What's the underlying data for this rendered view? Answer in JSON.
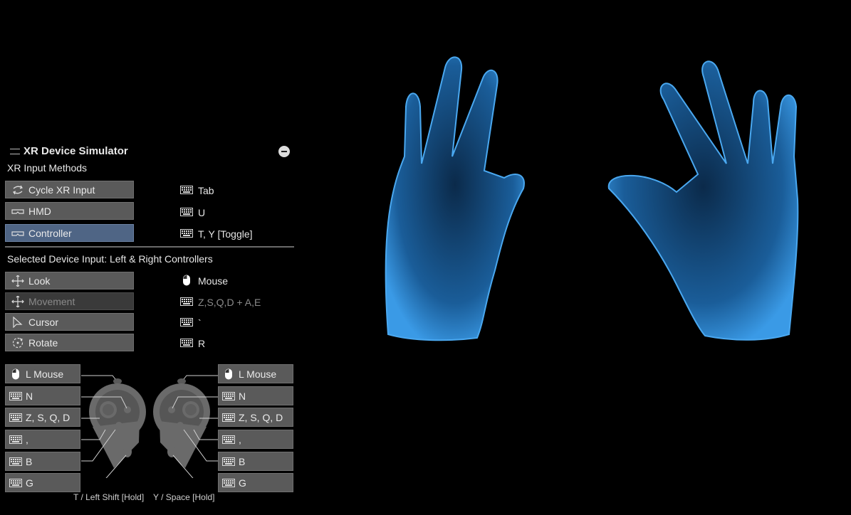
{
  "panel": {
    "title": "XR Device Simulator",
    "input_methods_label": "XR Input Methods",
    "input_methods": [
      {
        "label": "Cycle XR Input",
        "icon": "cycle-icon",
        "key": "Tab",
        "key_icon": "keyboard-icon",
        "state": "normal"
      },
      {
        "label": "HMD",
        "icon": "headset-icon",
        "key": "U",
        "key_icon": "keyboard-icon",
        "state": "normal"
      },
      {
        "label": "Controller",
        "icon": "headset-icon",
        "key": "T, Y [Toggle]",
        "key_icon": "keyboard-icon",
        "state": "active"
      }
    ],
    "selected_device_label": "Selected Device Input: Left & Right Controllers",
    "device_inputs": [
      {
        "label": "Look",
        "icon": "move-arrows-icon",
        "key": "Mouse",
        "key_icon": "mouse-icon",
        "state": "normal"
      },
      {
        "label": "Movement",
        "icon": "move-arrows-icon",
        "key": "Z,S,Q,D + A,E",
        "key_icon": "keyboard-icon",
        "state": "disabled"
      },
      {
        "label": "Cursor",
        "icon": "cursor-icon",
        "key": "`",
        "key_icon": "keyboard-icon",
        "state": "normal"
      },
      {
        "label": "Rotate",
        "icon": "rotate-icon",
        "key": "R",
        "key_icon": "keyboard-icon",
        "state": "normal"
      }
    ],
    "left_controller_bindings": [
      {
        "label": "L Mouse",
        "icon": "mouse-icon"
      },
      {
        "label": "N",
        "icon": "keyboard-icon"
      },
      {
        "label": "Z, S, Q, D",
        "icon": "keyboard-icon"
      },
      {
        "label": ",",
        "icon": "keyboard-icon"
      },
      {
        "label": "B",
        "icon": "keyboard-icon"
      },
      {
        "label": "G",
        "icon": "keyboard-icon"
      }
    ],
    "right_controller_bindings": [
      {
        "label": "L Mouse",
        "icon": "mouse-icon"
      },
      {
        "label": "N",
        "icon": "keyboard-icon"
      },
      {
        "label": "Z, S, Q, D",
        "icon": "keyboard-icon"
      },
      {
        "label": ",",
        "icon": "keyboard-icon"
      },
      {
        "label": "B",
        "icon": "keyboard-icon"
      },
      {
        "label": "G",
        "icon": "keyboard-icon"
      }
    ],
    "footer_left": "T / Left Shift [Hold]",
    "footer_right": "Y / Space [Hold]"
  },
  "colors": {
    "background": "#000000",
    "button": "#5a5a5a",
    "button_active": "#4f6585",
    "hand_blue": "#2a7fc8"
  }
}
